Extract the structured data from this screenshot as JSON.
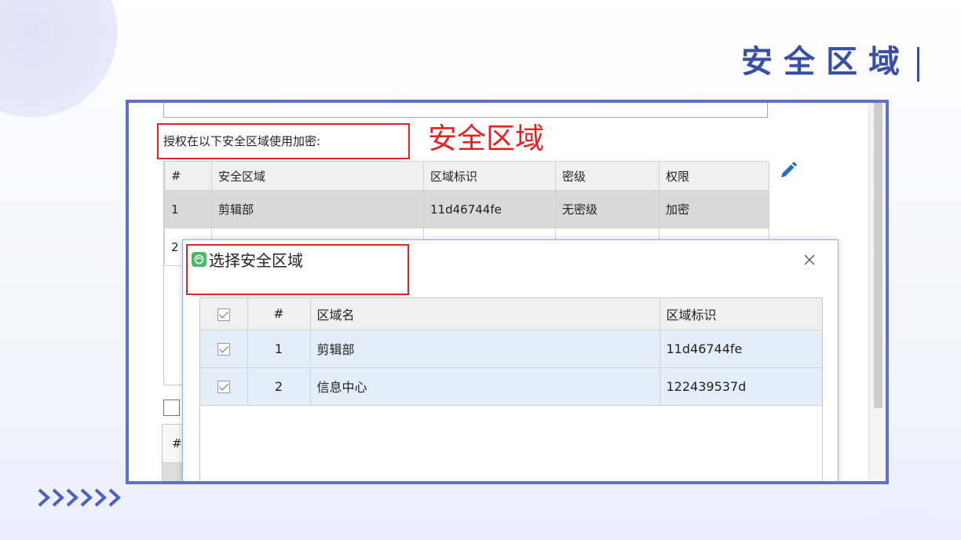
{
  "slide": {
    "title": "安全区域",
    "decoration_icon": "chevrons-right-icon"
  },
  "colors": {
    "accent": "#3b4ea6",
    "frame": "#5f70c8",
    "annotation": "#e02424",
    "selection": "#e3eef9",
    "pencil": "#1f6fd1"
  },
  "app": {
    "auth_label": "授权在以下安全区域使用加密:",
    "annotation": "安全区域",
    "edit_icon": "pencil-icon",
    "zone_table": {
      "columns": [
        "#",
        "安全区域",
        "区域标识",
        "密级",
        "权限"
      ],
      "rows": [
        [
          "1",
          "剪辑部",
          "11d46744fe",
          "无密级",
          "加密"
        ],
        [
          "2"
        ]
      ]
    },
    "standalone_checkbox_checked": false,
    "lower_table": {
      "columns": [
        "#"
      ]
    }
  },
  "dialog": {
    "title": "选择安全区域",
    "app_icon": "app-logo-icon",
    "close_icon": "close-icon",
    "table": {
      "header_checked": true,
      "columns": [
        "#",
        "区域名",
        "区域标识"
      ],
      "rows": [
        {
          "checked": true,
          "num": "1",
          "name": "剪辑部",
          "id": "11d46744fe"
        },
        {
          "checked": true,
          "num": "2",
          "name": "信息中心",
          "id": "122439537d"
        }
      ]
    }
  }
}
